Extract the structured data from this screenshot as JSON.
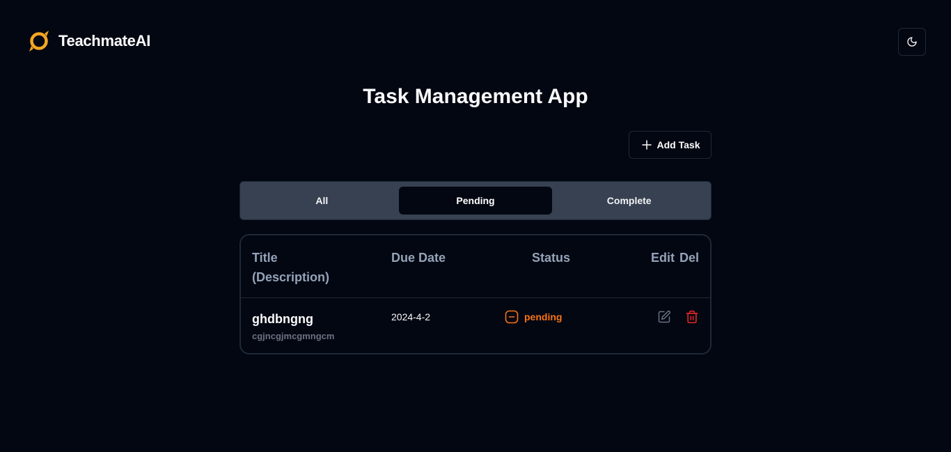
{
  "header": {
    "brand_name": "TeachmateAI",
    "theme_toggle_icon": "moon-icon"
  },
  "page": {
    "title": "Task Management App"
  },
  "toolbar": {
    "add_task_label": "Add Task",
    "add_task_icon": "plus-icon"
  },
  "tabs": [
    {
      "label": "All",
      "active": false
    },
    {
      "label": "Pending",
      "active": true
    },
    {
      "label": "Complete",
      "active": false
    }
  ],
  "table": {
    "headers": {
      "title": "Title (Description)",
      "due_date": "Due Date",
      "status": "Status",
      "edit": "Edit",
      "delete": "Del"
    },
    "rows": [
      {
        "title": "ghdbngng",
        "description": "cgjncgjmcgmngcm",
        "due_date": "2024-4-2",
        "status": "pending",
        "status_icon": "minus-circle-icon",
        "edit_icon": "edit-icon",
        "delete_icon": "trash-icon"
      }
    ]
  },
  "colors": {
    "background": "#030712",
    "brand_accent": "#f5a623",
    "status_pending": "#f97316",
    "delete": "#dc2626",
    "muted_header": "#94a3b8",
    "tabs_background": "#374151"
  }
}
